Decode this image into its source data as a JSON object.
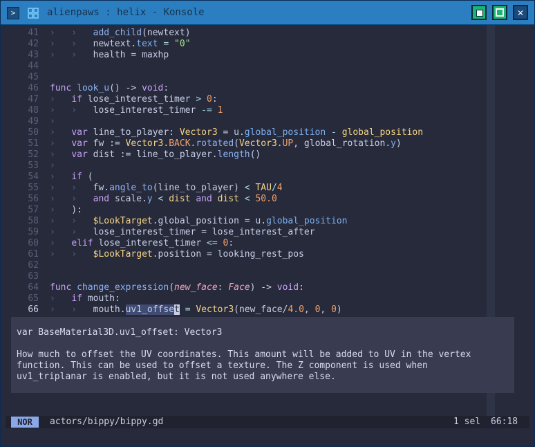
{
  "window": {
    "title": "alienpaws : helix - Konsole",
    "menu_glyph": ">",
    "close_glyph": "✕"
  },
  "colors": {
    "titlebar": "#2b7ec0",
    "editor_bg": "#272a3b",
    "popup_bg": "#393c50",
    "mode_badge": "#8aa8e8"
  },
  "editor": {
    "lines": [
      {
        "n": "41",
        "tokens": [
          {
            "t": "›   ›   ",
            "c": "ind"
          },
          {
            "t": "add_child",
            "c": "fn"
          },
          {
            "t": "(newtext)",
            "c": "pu"
          }
        ]
      },
      {
        "n": "42",
        "tokens": [
          {
            "t": "›   ›   ",
            "c": "ind"
          },
          {
            "t": "newtext.",
            "c": "pu"
          },
          {
            "t": "text",
            "c": "pr"
          },
          {
            "t": " = ",
            "c": "op"
          },
          {
            "t": "\"0\"",
            "c": "st"
          }
        ]
      },
      {
        "n": "43",
        "tokens": [
          {
            "t": "›   ›   ",
            "c": "ind"
          },
          {
            "t": "health = maxhp",
            "c": "pu"
          }
        ]
      },
      {
        "n": "44",
        "tokens": []
      },
      {
        "n": "45",
        "tokens": []
      },
      {
        "n": "46",
        "tokens": [
          {
            "t": "func ",
            "c": "kw"
          },
          {
            "t": "look_u",
            "c": "fn"
          },
          {
            "t": "() -> ",
            "c": "pu"
          },
          {
            "t": "void",
            "c": "kw"
          },
          {
            "t": ":",
            "c": "pu"
          }
        ]
      },
      {
        "n": "47",
        "tokens": [
          {
            "t": "›   ",
            "c": "ind"
          },
          {
            "t": "if ",
            "c": "kw"
          },
          {
            "t": "lose_interest_timer ",
            "c": "pu"
          },
          {
            "t": "> ",
            "c": "op"
          },
          {
            "t": "0",
            "c": "nu"
          },
          {
            "t": ":",
            "c": "pu"
          }
        ]
      },
      {
        "n": "48",
        "tokens": [
          {
            "t": "›   ›   ",
            "c": "ind"
          },
          {
            "t": "lose_interest_timer ",
            "c": "pu"
          },
          {
            "t": "-= ",
            "c": "op"
          },
          {
            "t": "1",
            "c": "nu"
          }
        ]
      },
      {
        "n": "49",
        "tokens": [
          {
            "t": "›",
            "c": "ind"
          }
        ]
      },
      {
        "n": "50",
        "tokens": [
          {
            "t": "›   ",
            "c": "ind"
          },
          {
            "t": "var ",
            "c": "kw"
          },
          {
            "t": "line_to_player: ",
            "c": "pu"
          },
          {
            "t": "Vector3",
            "c": "ty"
          },
          {
            "t": " = u.",
            "c": "pu"
          },
          {
            "t": "global_position",
            "c": "pr"
          },
          {
            "t": " - ",
            "c": "op"
          },
          {
            "t": "global_position",
            "c": "ty"
          }
        ]
      },
      {
        "n": "51",
        "tokens": [
          {
            "t": "›   ",
            "c": "ind"
          },
          {
            "t": "var ",
            "c": "kw"
          },
          {
            "t": "fw := ",
            "c": "pu"
          },
          {
            "t": "Vector3",
            "c": "ty"
          },
          {
            "t": ".",
            "c": "pu"
          },
          {
            "t": "BACK",
            "c": "nu"
          },
          {
            "t": ".",
            "c": "pu"
          },
          {
            "t": "rotated",
            "c": "fn"
          },
          {
            "t": "(",
            "c": "pu"
          },
          {
            "t": "Vector3",
            "c": "ty"
          },
          {
            "t": ".",
            "c": "pu"
          },
          {
            "t": "UP",
            "c": "nu"
          },
          {
            "t": ", global_rotation.",
            "c": "pu"
          },
          {
            "t": "y",
            "c": "pr"
          },
          {
            "t": ")",
            "c": "pu"
          }
        ]
      },
      {
        "n": "52",
        "tokens": [
          {
            "t": "›   ",
            "c": "ind"
          },
          {
            "t": "var ",
            "c": "kw"
          },
          {
            "t": "dist := line_to_player.",
            "c": "pu"
          },
          {
            "t": "length",
            "c": "fn"
          },
          {
            "t": "()",
            "c": "pu"
          }
        ]
      },
      {
        "n": "53",
        "tokens": [
          {
            "t": "›",
            "c": "ind"
          }
        ]
      },
      {
        "n": "54",
        "tokens": [
          {
            "t": "›   ",
            "c": "ind"
          },
          {
            "t": "if ",
            "c": "kw"
          },
          {
            "t": "(",
            "c": "pu"
          }
        ]
      },
      {
        "n": "55",
        "tokens": [
          {
            "t": "›   ›   ",
            "c": "ind"
          },
          {
            "t": "fw.",
            "c": "pu"
          },
          {
            "t": "angle_to",
            "c": "fn"
          },
          {
            "t": "(line_to_player) ",
            "c": "pu"
          },
          {
            "t": "< ",
            "c": "op"
          },
          {
            "t": "TAU",
            "c": "ty"
          },
          {
            "t": "/",
            "c": "op"
          },
          {
            "t": "4",
            "c": "nu"
          }
        ]
      },
      {
        "n": "56",
        "tokens": [
          {
            "t": "›   ›   ",
            "c": "ind"
          },
          {
            "t": "and ",
            "c": "kw"
          },
          {
            "t": "scale.",
            "c": "pu"
          },
          {
            "t": "y",
            "c": "pr"
          },
          {
            "t": " < ",
            "c": "op"
          },
          {
            "t": "dist ",
            "c": "ty"
          },
          {
            "t": "and ",
            "c": "kw"
          },
          {
            "t": "dist ",
            "c": "ty"
          },
          {
            "t": "< ",
            "c": "op"
          },
          {
            "t": "50.0",
            "c": "nu"
          }
        ]
      },
      {
        "n": "57",
        "tokens": [
          {
            "t": "›   ",
            "c": "ind"
          },
          {
            "t": "):",
            "c": "pu"
          }
        ]
      },
      {
        "n": "58",
        "tokens": [
          {
            "t": "›   ›   ",
            "c": "ind"
          },
          {
            "t": "$LookTarget",
            "c": "ty"
          },
          {
            "t": ".global_position = u.",
            "c": "pu"
          },
          {
            "t": "global_position",
            "c": "pr"
          }
        ]
      },
      {
        "n": "59",
        "tokens": [
          {
            "t": "›   ›   ",
            "c": "ind"
          },
          {
            "t": "lose_interest_timer = lose_interest_after",
            "c": "pu"
          }
        ]
      },
      {
        "n": "60",
        "tokens": [
          {
            "t": "›   ",
            "c": "ind"
          },
          {
            "t": "elif ",
            "c": "kw"
          },
          {
            "t": "lose_interest_timer ",
            "c": "pu"
          },
          {
            "t": "<= ",
            "c": "op"
          },
          {
            "t": "0",
            "c": "nu"
          },
          {
            "t": ":",
            "c": "pu"
          }
        ]
      },
      {
        "n": "61",
        "tokens": [
          {
            "t": "›   ›   ",
            "c": "ind"
          },
          {
            "t": "$LookTarget",
            "c": "ty"
          },
          {
            "t": ".position = looking_rest_pos",
            "c": "pu"
          }
        ]
      },
      {
        "n": "62",
        "tokens": []
      },
      {
        "n": "63",
        "tokens": []
      },
      {
        "n": "64",
        "tokens": [
          {
            "t": "func ",
            "c": "kw"
          },
          {
            "t": "change_expression",
            "c": "fn"
          },
          {
            "t": "(",
            "c": "pu"
          },
          {
            "t": "new_face",
            "c": "pa"
          },
          {
            "t": ": ",
            "c": "pu"
          },
          {
            "t": "Face",
            "c": "pa"
          },
          {
            "t": ") -> ",
            "c": "pu"
          },
          {
            "t": "void",
            "c": "kw"
          },
          {
            "t": ":",
            "c": "pu"
          }
        ]
      },
      {
        "n": "65",
        "tokens": [
          {
            "t": "›   ",
            "c": "ind"
          },
          {
            "t": "if ",
            "c": "kw"
          },
          {
            "t": "mouth:",
            "c": "pu"
          }
        ]
      },
      {
        "n": "66",
        "cur": true,
        "tokens": [
          {
            "t": "›   ›   ",
            "c": "ind"
          },
          {
            "t": "mouth.",
            "c": "pu"
          },
          {
            "t": "uv1_offse",
            "c": "sel"
          },
          {
            "t": "t",
            "c": "cursor"
          },
          {
            "t": " = ",
            "c": "op"
          },
          {
            "t": "Vector3",
            "c": "ty"
          },
          {
            "t": "(new_face/",
            "c": "pu"
          },
          {
            "t": "4.0",
            "c": "nu"
          },
          {
            "t": ", ",
            "c": "pu"
          },
          {
            "t": "0",
            "c": "nu"
          },
          {
            "t": ", ",
            "c": "pu"
          },
          {
            "t": "0",
            "c": "nu"
          },
          {
            "t": ")",
            "c": "pu"
          }
        ]
      }
    ]
  },
  "hover": {
    "signature": "var BaseMaterial3D.uv1_offset: Vector3",
    "doc_lines": [
      "How much to offset the UV coordinates. This amount will be added to UV in the vertex",
      "function. This can be used to offset a texture. The Z component is used when",
      "uv1_triplanar is enabled, but it is not used anywhere else."
    ]
  },
  "statusline": {
    "mode": "NOR",
    "file": "actors/bippy/bippy.gd",
    "selections": "1 sel",
    "position": "66:18"
  }
}
